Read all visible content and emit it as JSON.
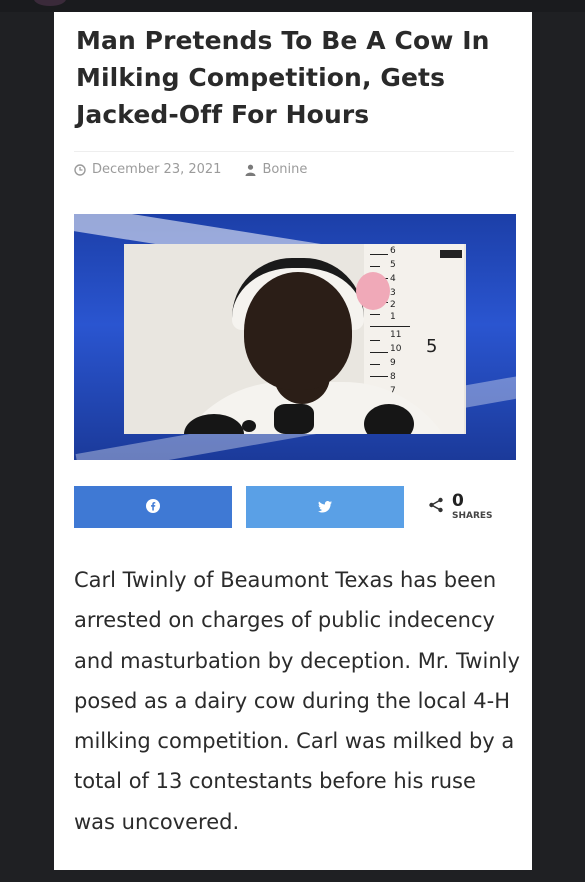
{
  "headline": "Man Pretends To Be A Cow In Milking Competition, Gets Jacked-Off For Hours",
  "meta": {
    "date": "December 23, 2021",
    "author": "Bonine"
  },
  "photo": {
    "ruler_numbers": [
      "6",
      "5",
      "4",
      "3",
      "2",
      "1",
      "11",
      "10",
      "9",
      "8",
      "7"
    ],
    "ruler_big_number": "5"
  },
  "share": {
    "facebook_icon": "facebook-icon",
    "twitter_icon": "twitter-icon",
    "share_icon": "share-icon",
    "count": "0",
    "count_label": "SHARES"
  },
  "article": {
    "body": "Carl Twinly of Beaumont Texas has been arrested on charges of public indecency and masturbation by deception. Mr. Twinly posed as a dairy cow during the local 4-H milking competition. Carl was milked by a total of 13 contestants before his ruse was uncovered."
  },
  "colors": {
    "background": "#1f2023",
    "card": "#ffffff",
    "facebook": "#3f79d4",
    "twitter": "#5aa0e6",
    "photo_blue": "#2a55d0"
  }
}
